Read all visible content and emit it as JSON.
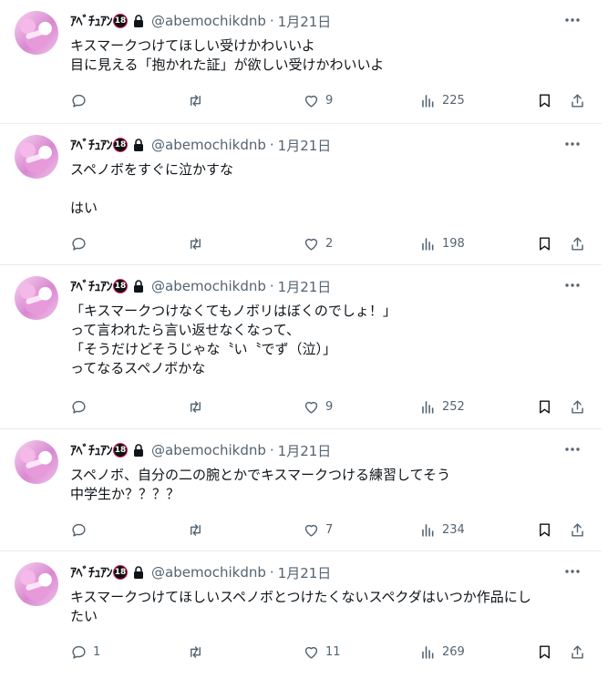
{
  "tweets": [
    {
      "name": "ｱﾍﾞﾁｭｱﾝ",
      "badge": "18",
      "handle": "@abemochikdnb",
      "date": "1月21日",
      "lines": [
        "キスマークつけてほしい受けかわいいよ",
        "目に見える「抱かれた証」が欲しい受けかわいいよ"
      ],
      "replies": "",
      "retweets": "",
      "likes": "9",
      "views": "225"
    },
    {
      "name": "ｱﾍﾞﾁｭｱﾝ",
      "badge": "18",
      "handle": "@abemochikdnb",
      "date": "1月21日",
      "lines": [
        "スペノボをすぐに泣かすな",
        "",
        "はい"
      ],
      "replies": "",
      "retweets": "",
      "likes": "2",
      "views": "198"
    },
    {
      "name": "ｱﾍﾞﾁｭｱﾝ",
      "badge": "18",
      "handle": "@abemochikdnb",
      "date": "1月21日",
      "lines": [
        "「キスマークつけなくてもノボリはぼくのでしょ！」",
        "って言われたら言い返せなくなって、",
        "「そうだけどそうじゃな〝い〝でず（泣）」",
        "ってなるスペノボかな"
      ],
      "replies": "",
      "retweets": "",
      "likes": "9",
      "views": "252"
    },
    {
      "name": "ｱﾍﾞﾁｭｱﾝ",
      "badge": "18",
      "handle": "@abemochikdnb",
      "date": "1月21日",
      "lines": [
        "スペノボ、自分の二の腕とかでキスマークつける練習してそう",
        "中学生か？？？？"
      ],
      "replies": "",
      "retweets": "",
      "likes": "7",
      "views": "234"
    },
    {
      "name": "ｱﾍﾞﾁｭｱﾝ",
      "badge": "18",
      "handle": "@abemochikdnb",
      "date": "1月21日",
      "lines": [
        "キスマークつけてほしいスペノボとつけたくないスペクダはいつか作品にし",
        "たい"
      ],
      "replies": "1",
      "retweets": "",
      "likes": "11",
      "views": "269"
    }
  ],
  "colors": {
    "text": "#0f1419",
    "muted": "#536471",
    "border": "#e6ecf0",
    "badge_ring": "#e0245e"
  },
  "icons": [
    "reply-icon",
    "retweet-icon",
    "like-icon",
    "views-icon",
    "bookmark-icon",
    "share-icon",
    "lock-icon",
    "more-icon"
  ]
}
